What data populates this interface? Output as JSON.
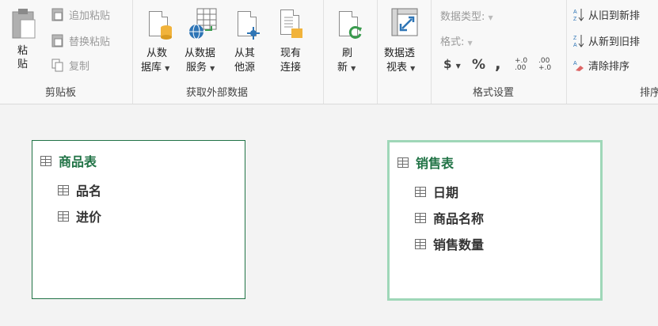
{
  "ribbon": {
    "clipboard": {
      "paste_label_1": "粘",
      "paste_label_2": "贴",
      "append_paste": "追加粘贴",
      "replace_paste": "替换粘贴",
      "copy": "复制",
      "group_label": "剪贴板"
    },
    "get_external": {
      "from_db_1": "从数",
      "from_db_2": "据库",
      "from_service_1": "从数据",
      "from_service_2": "服务",
      "from_other_1": "从其",
      "from_other_2": "他源",
      "existing_1": "现有",
      "existing_2": "连接",
      "group_label": "获取外部数据"
    },
    "refresh": {
      "label_1": "刷",
      "label_2": "新"
    },
    "pivot": {
      "label_1": "数据透",
      "label_2": "视表"
    },
    "format": {
      "data_type": "数据类型:",
      "format": "格式:",
      "currency": "$",
      "percent": "%",
      "comma": ",",
      "inc_decimal": "+.0 .00",
      "dec_decimal": ".00 +.0",
      "group_label": "格式设置"
    },
    "sort": {
      "old_to_new": "从旧到新排",
      "new_to_old": "从新到旧排",
      "clear_sort": "清除排序",
      "group_label": "排序"
    }
  },
  "tables": [
    {
      "title": "商品表",
      "fields": [
        "品名",
        "进价"
      ]
    },
    {
      "title": "销售表",
      "fields": [
        "日期",
        "商品名称",
        "销售数量"
      ]
    }
  ],
  "colors": {
    "accent": "#217346",
    "selected_border": "#9fd7b8"
  }
}
